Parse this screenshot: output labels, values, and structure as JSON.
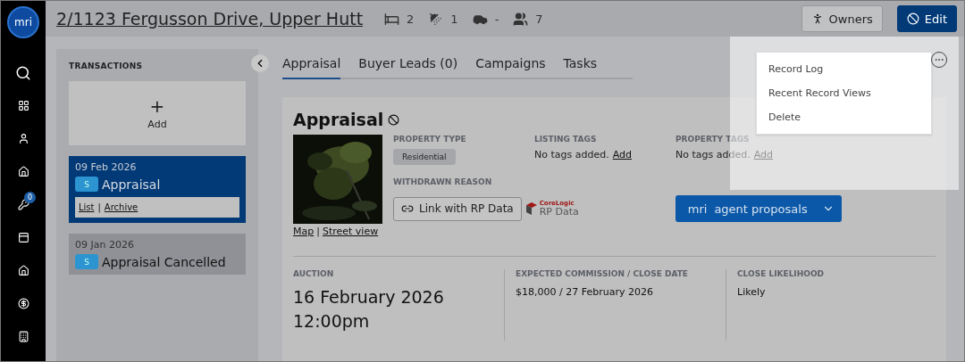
{
  "header": {
    "title": "2/1123 Fergusson Drive, Upper Hutt",
    "stats": [
      {
        "kind": "bed",
        "value": "2"
      },
      {
        "kind": "shower",
        "value": "1"
      },
      {
        "kind": "car",
        "value": "-"
      },
      {
        "kind": "people",
        "value": "7"
      }
    ],
    "buttons": [
      {
        "kind": "owners",
        "label": "Owners"
      },
      {
        "kind": "edit",
        "label": "Edit"
      }
    ]
  },
  "rail": {
    "logo": "mri",
    "items": [
      {
        "kind": "search"
      },
      {
        "kind": "grid"
      },
      {
        "kind": "user"
      },
      {
        "kind": "home"
      },
      {
        "kind": "key",
        "badge": "0"
      },
      {
        "kind": "board"
      },
      {
        "kind": "house"
      },
      {
        "kind": "dollar"
      },
      {
        "kind": "building"
      }
    ]
  },
  "transactions": {
    "heading": "TRANSACTIONS",
    "add": {
      "icon": "+",
      "label": "Add"
    },
    "items": [
      {
        "date": "09 Feb 2026",
        "badge": "S",
        "title": "Appraisal",
        "selected": true,
        "links": [
          "List",
          "Archive"
        ],
        "separator": "|"
      },
      {
        "date": "09 Jan 2026",
        "badge": "S",
        "title": "Appraisal Cancelled",
        "selected": false
      }
    ]
  },
  "tabs": [
    {
      "label": "Appraisal",
      "selected": true
    },
    {
      "label": "Buyer Leads (0)",
      "selected": false
    },
    {
      "label": "Campaigns",
      "selected": false
    },
    {
      "label": "Tasks",
      "selected": false
    }
  ],
  "appraisal": {
    "title": "Appraisal",
    "photo_links": [
      "Map",
      "Street view"
    ],
    "photo_separator": "|",
    "property_type": {
      "label": "PROPERTY TYPE",
      "value": "Residential"
    },
    "listing_tags": {
      "label": "LISTING TAGS",
      "text": "No tags added.",
      "link": "Add"
    },
    "property_tags": {
      "label": "PROPERTY TAGS",
      "text": "No tags added.",
      "link": "Add"
    },
    "withdrawn_reason": {
      "label": "WITHDRAWN REASON"
    },
    "rp_button": "Link with RP Data",
    "rp_logo": {
      "brand": "CoreLogic",
      "text": "RP Data"
    },
    "proposals_button": {
      "logo": "mri",
      "label": "agent proposals"
    },
    "details": [
      {
        "label": "AUCTION",
        "value": "16 February 2026 12:00pm",
        "kind": "large"
      },
      {
        "label": "EXPECTED COMMISSION / CLOSE DATE",
        "value": "$18,000 / 27 February 2026",
        "kind": "normal"
      },
      {
        "label": "CLOSE LIKELIHOOD",
        "value": "Likely",
        "kind": "normal"
      }
    ]
  },
  "menu": {
    "items": [
      "Record Log",
      "Recent Record Views",
      "Delete"
    ]
  }
}
